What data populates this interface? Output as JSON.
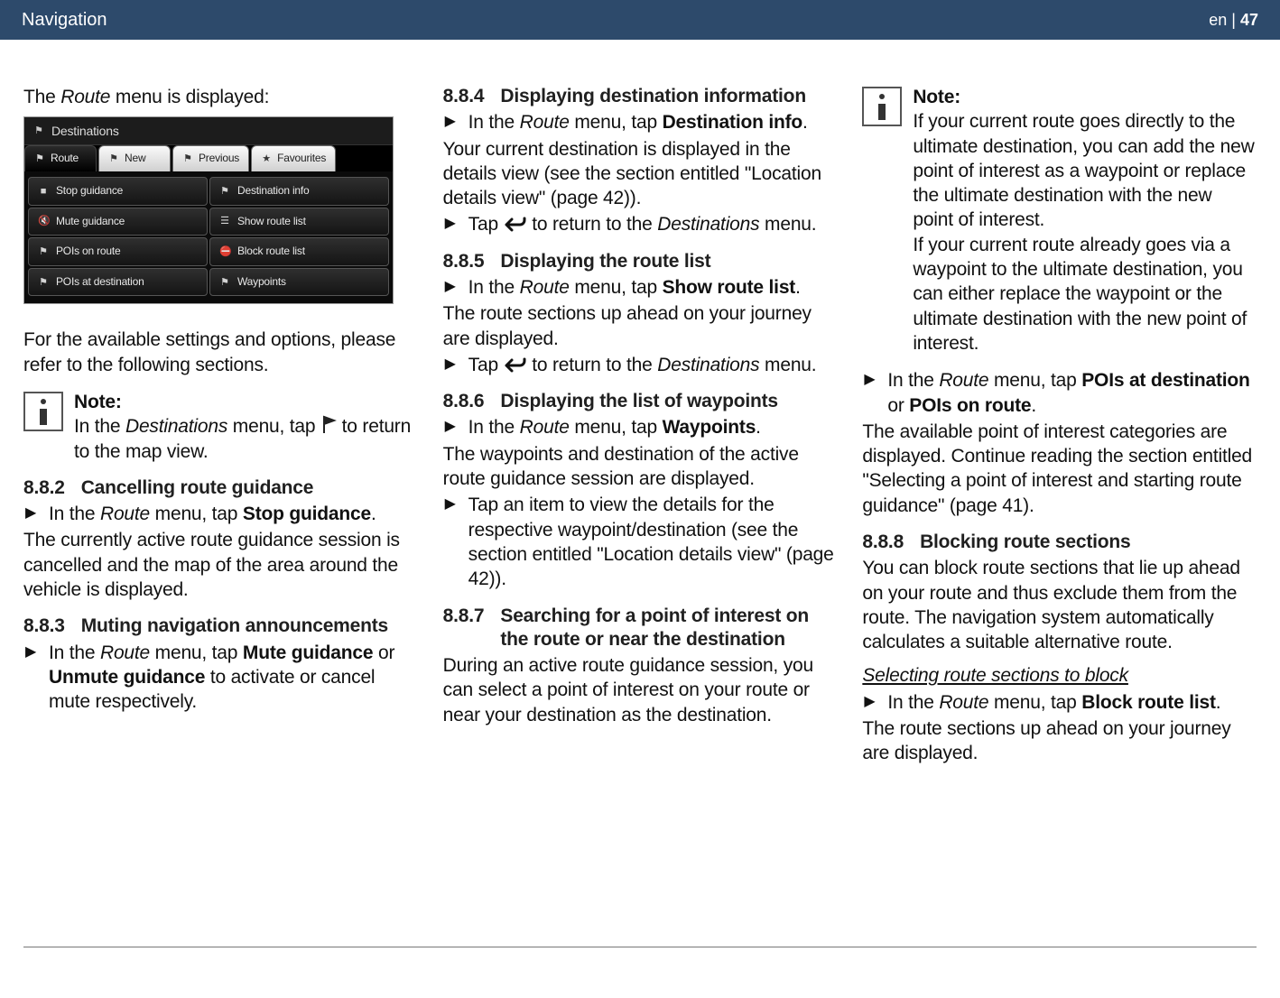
{
  "header": {
    "left": "Navigation",
    "right_prefix": "en | ",
    "right_page": "47"
  },
  "col1": {
    "intro_before": "The ",
    "intro_italic": "Route",
    "intro_after": " menu is displayed:",
    "after_device": "For the available settings and options, please refer to the following sections.",
    "note": {
      "title": "Note:",
      "l1a": "In the ",
      "l1b": "Destinations",
      "l1c": " menu, tap ",
      "l1d": " to return to the map view."
    },
    "s882": {
      "num": "8.8.2",
      "title": "Cancelling route guidance",
      "step_a": "In the ",
      "step_b": "Route",
      "step_c": " menu, tap ",
      "step_d": "Stop guidance",
      "step_e": ".",
      "para": "The currently active route guidance session is cancelled and the map of the area around the vehicle is displayed."
    },
    "s883": {
      "num": "8.8.3",
      "title": "Muting navigation announcements",
      "step_a": "In the ",
      "step_b": "Route",
      "step_c": " menu, tap ",
      "step_d": "Mute guidance",
      "step_e": " or ",
      "step_f": "Unmute guidance",
      "step_g": " to activate or cancel mute respectively."
    }
  },
  "device": {
    "title": "Destinations",
    "tabs": [
      "Route",
      "New",
      "Previous",
      "Favourites"
    ],
    "buttons": [
      "Stop guidance",
      "Destination info",
      "Mute guidance",
      "Show route list",
      "POIs on route",
      "Block route list",
      "POIs at destination",
      "Waypoints"
    ]
  },
  "col2": {
    "s884": {
      "num": "8.8.4",
      "title": "Displaying destination information",
      "step_a": "In the ",
      "step_b": "Route",
      "step_c": " menu, tap ",
      "step_d": "Destination info",
      "step_e": ".",
      "para": "Your current destination is displayed in the details view (see the section entitled \"Location details view\" (page 42)).",
      "ret_a": "Tap ",
      "ret_b": " to return to the ",
      "ret_c": "Destinations",
      "ret_d": " menu."
    },
    "s885": {
      "num": "8.8.5",
      "title": "Displaying the route list",
      "step_a": "In the ",
      "step_b": "Route",
      "step_c": " menu, tap ",
      "step_d": "Show route list",
      "step_e": ".",
      "para": "The route sections up ahead on your journey are displayed.",
      "ret_a": "Tap ",
      "ret_b": " to return to the ",
      "ret_c": "Destinations",
      "ret_d": " menu."
    },
    "s886": {
      "num": "8.8.6",
      "title": "Displaying the list of waypoints",
      "step_a": "In the ",
      "step_b": "Route",
      "step_c": " menu, tap ",
      "step_d": "Waypoints",
      "step_e": ".",
      "para": "The waypoints and destination of the active route guidance session are displayed.",
      "step2": "Tap an item to view the details for the respective waypoint/destination (see the section entitled \"Location details view\" (page 42))."
    },
    "s887": {
      "num": "8.8.7",
      "title": "Searching for a point of interest on the route or near the destination",
      "para": "During an active route guidance session, you can select a point of interest on your route or near your destination as the destination."
    }
  },
  "col3": {
    "note": {
      "title": "Note:",
      "body": "If your current route goes directly to the ultimate destination, you can add the new point of interest as a waypoint or replace the ultimate destination with the new point of interest.\nIf your current route already goes via a waypoint to the ultimate destination, you can either replace the waypoint or the ultimate destination with the new point of interest."
    },
    "step_a": "In the ",
    "step_b": "Route",
    "step_c": " menu, tap ",
    "step_d": "POIs at destination",
    "step_e": " or ",
    "step_f": "POIs on route",
    "step_g": ".",
    "para": "The available point of interest categories are displayed. Continue reading the section entitled \"Selecting a point of interest and starting route guidance\" (page 41).",
    "s888": {
      "num": "8.8.8",
      "title": "Blocking route sections",
      "para": "You can block route sections that lie up ahead on your route and thus exclude them from the route. The navigation system automatically calculates a suitable alternative route."
    },
    "sub": {
      "title": "Selecting route sections to block",
      "step_a": "In the ",
      "step_b": "Route",
      "step_c": " menu, tap ",
      "step_d": "Block route list",
      "step_e": ".",
      "para": "The route sections up ahead on your journey are displayed."
    }
  }
}
